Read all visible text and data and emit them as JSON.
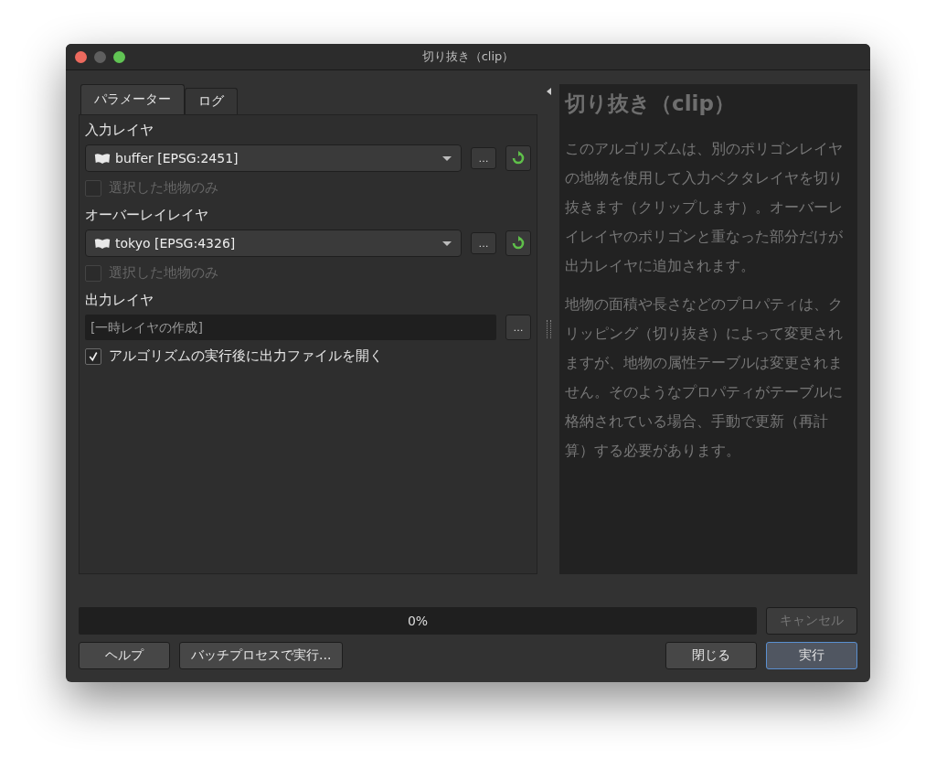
{
  "window": {
    "title": "切り抜き（clip）"
  },
  "tabs": [
    {
      "label": "パラメーター",
      "selected": true
    },
    {
      "label": "ログ",
      "selected": false
    }
  ],
  "parameters": [
    {
      "kind": "label",
      "text": "入力レイヤ"
    },
    {
      "kind": "layer",
      "value": "buffer [EPSG:2451]",
      "browse": "…"
    },
    {
      "kind": "checkbox",
      "label": "選択した地物のみ",
      "checked": false,
      "disabled": true
    },
    {
      "kind": "label",
      "text": "オーバーレイレイヤ"
    },
    {
      "kind": "layer",
      "value": "tokyo [EPSG:4326]",
      "browse": "…"
    },
    {
      "kind": "checkbox",
      "label": "選択した地物のみ",
      "checked": false,
      "disabled": true
    },
    {
      "kind": "label",
      "text": "出力レイヤ"
    },
    {
      "kind": "output",
      "placeholder": "[一時レイヤの作成]",
      "browse": "…"
    },
    {
      "kind": "checkbox",
      "label": "アルゴリズムの実行後に出力ファイルを開く",
      "checked": true,
      "disabled": false
    }
  ],
  "help": {
    "title": "切り抜き（clip）",
    "paragraphs": [
      "このアルゴリズムは、別のポリゴンレイヤの地物を使用して入力ベクタレイヤを切り抜きます（クリップします）。オーバーレイレイヤのポリゴンと重なった部分だけが出力レイヤに追加されます。",
      "地物の面積や長さなどのプロパティは、クリッピング（切り抜き）によって変更されますが、地物の属性テーブルは変更されません。そのようなプロパティがテーブルに格納されている場合、手動で更新（再計算）する必要があります。"
    ]
  },
  "progress": {
    "level": 0,
    "text": "0%"
  },
  "cancel_button": {
    "label": "キャンセル",
    "disabled": true
  },
  "buttons_left": [
    {
      "label": "ヘルプ",
      "default": false
    },
    {
      "label": "バッチプロセスで実行...",
      "default": false
    }
  ],
  "buttons_right": [
    {
      "label": "閉じる",
      "default": false
    },
    {
      "label": "実行",
      "default": true
    }
  ]
}
